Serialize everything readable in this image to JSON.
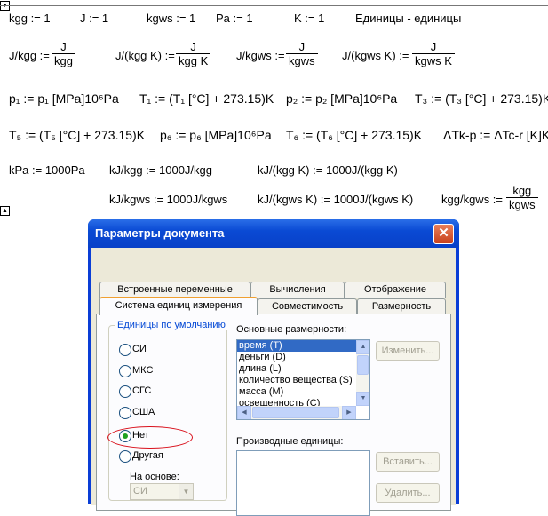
{
  "worksheet": {
    "row1": {
      "kgg": "kgg := 1",
      "J": "J := 1",
      "kgws": "kgws := 1",
      "Pa": "Pa := 1",
      "K": "K := 1",
      "units_note": "Единицы - единицы"
    },
    "row2": [
      {
        "lhs": "J/kgg :=",
        "num": "J",
        "den": "kgg"
      },
      {
        "lhs": "J/(kgg K) :=",
        "num": "J",
        "den": "kgg K"
      },
      {
        "lhs": "J/kgws :=",
        "num": "J",
        "den": "kgws"
      },
      {
        "lhs": "J/(kgws K) :=",
        "num": "J",
        "den": "kgws K"
      }
    ],
    "row3": {
      "p1": "p₁ := p₁ [MPa]10⁶Pa",
      "T1": "T₁ := (T₁ [°C] + 273.15)K",
      "p2": "p₂ := p₂ [MPa]10⁶Pa",
      "T3": "T₃ := (T₃ [°C] + 273.15)K"
    },
    "row4": {
      "T5": "T₅ := (T₅ [°C] + 273.15)K",
      "p6": "p₆ := p₆ [MPa]10⁶Pa",
      "T6": "T₆ := (T₆ [°C] + 273.15)K",
      "dT": "ΔTk-p := ΔTc-r [K]K"
    },
    "row5": {
      "kPa": "kPa := 1000Pa",
      "kJkgg": "kJ/kgg := 1000J/kgg",
      "kJkggK": "kJ/(kgg K) := 1000J/(kgg K)"
    },
    "row6": {
      "kJkgws": "kJ/kgws := 1000J/kgws",
      "kJkgwsK": "kJ/(kgws K) := 1000J/(kgws K)",
      "ratio_lhs": "kgg/kgws :=",
      "ratio_num": "kgg",
      "ratio_den": "kgws"
    }
  },
  "dialog": {
    "title": "Параметры документа",
    "tabs_row1": [
      "Встроенные переменные",
      "Вычисления",
      "Отображение"
    ],
    "tabs_row2": [
      "Система единиц измерения",
      "Совместимость",
      "Размерность"
    ],
    "default_units_group": "Единицы по умолчанию",
    "unit_options": [
      {
        "label": "СИ",
        "selected": false
      },
      {
        "label": "МКС",
        "selected": false
      },
      {
        "label": "СГС",
        "selected": false
      },
      {
        "label": "США",
        "selected": false
      },
      {
        "label": "Нет",
        "selected": true
      },
      {
        "label": "Другая",
        "selected": false
      }
    ],
    "based_on_label": "На основе:",
    "based_on_value": "СИ",
    "base_dimensions_label": "Основные размерности:",
    "base_dimensions": [
      "время (T)",
      "деньги (D)",
      "длина (L)",
      "количество вещества (S)",
      "масса (M)",
      "освещенность (C)"
    ],
    "derived_units_label": "Производные единицы:",
    "buttons": {
      "change": "Изменить...",
      "insert": "Вставить...",
      "delete": "Удалить..."
    }
  },
  "colors": {
    "title_bar": "#0a4ad4",
    "selected_item": "#316ac5",
    "highlight_ellipse": "#d9111c",
    "radio_dot": "#21a121"
  }
}
